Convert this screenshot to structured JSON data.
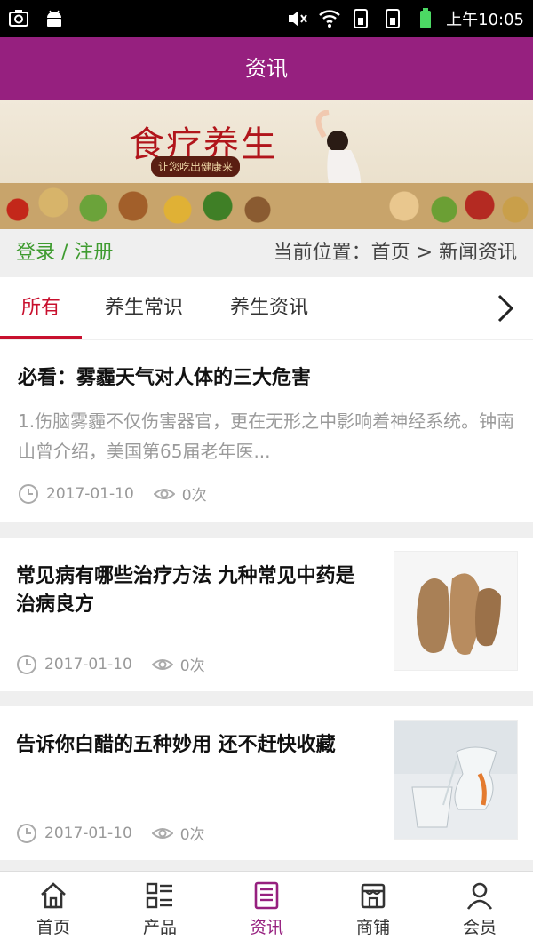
{
  "status_bar": {
    "time": "上午10:05"
  },
  "header": {
    "title": "资讯"
  },
  "banner": {
    "brand_text": "食疗养生",
    "slogan": "让您吃出健康来"
  },
  "location_bar": {
    "login_text": "登录 / 注册",
    "location_text": "当前位置：首页 > 新闻资讯"
  },
  "tabs": [
    {
      "label": "所有",
      "active": true
    },
    {
      "label": "养生常识",
      "active": false
    },
    {
      "label": "养生资讯",
      "active": false
    }
  ],
  "articles": [
    {
      "title": "必看：雾霾天气对人体的三大危害",
      "desc": "1.伤脑雾霾不仅伤害器官，更在无形之中影响着神经系统。钟南山曾介绍，美国第65届老年医...",
      "date": "2017-01-10",
      "views": "0次"
    },
    {
      "title": "常见病有哪些治疗方法 九种常见中药是治病良方",
      "date": "2017-01-10",
      "views": "0次"
    },
    {
      "title": "告诉你白醋的五种妙用 还不赶快收藏",
      "date": "2017-01-10",
      "views": "0次"
    }
  ],
  "bottom_nav": [
    {
      "label": "首页",
      "icon": "home-icon"
    },
    {
      "label": "产品",
      "icon": "grid-list-icon"
    },
    {
      "label": "资讯",
      "icon": "news-icon",
      "active": true
    },
    {
      "label": "商铺",
      "icon": "shop-icon"
    },
    {
      "label": "会员",
      "icon": "user-icon"
    }
  ],
  "colors": {
    "header": "#96207f",
    "accent_tab": "#c8102e",
    "login_green": "#3e9b2f"
  }
}
